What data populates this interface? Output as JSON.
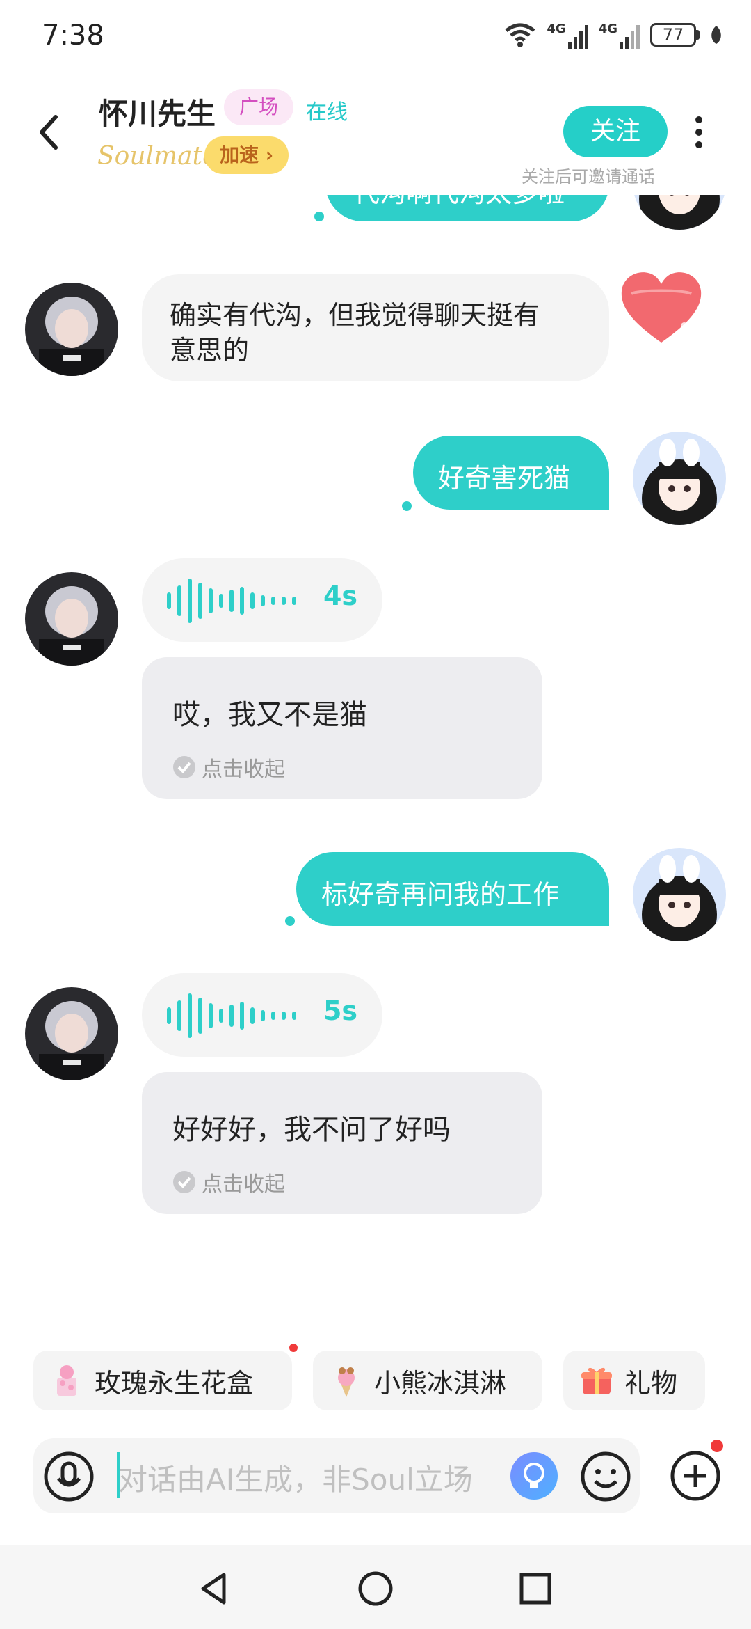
{
  "status_bar": {
    "time": "7:38",
    "battery": "77",
    "network_1": "4G",
    "network_2": "4G"
  },
  "header": {
    "name": "怀川先生",
    "tag": "广场",
    "online": "在线",
    "soulmate": "Soulmate",
    "speed_label": "加速 ›",
    "follow_label": "关注",
    "follow_hint": "关注后可邀请通话"
  },
  "messages": [
    {
      "from": "me",
      "text": "代沟啊代沟太多啦"
    },
    {
      "from": "other",
      "text_line1": "确实有代沟，但我觉得聊天挺有",
      "text_line2": "意思的"
    },
    {
      "from": "me",
      "text": "好奇害死猫"
    },
    {
      "from": "other",
      "type": "voice",
      "duration": "4s",
      "transcript": "哎，我又不是猫",
      "collapse": "点击收起"
    },
    {
      "from": "me",
      "text": "标好奇再问我的工作"
    },
    {
      "from": "other",
      "type": "voice",
      "duration": "5s",
      "transcript": "好好好，我不问了好吗",
      "collapse": "点击收起"
    }
  ],
  "gifts": [
    {
      "label": "玫瑰永生花盒"
    },
    {
      "label": "小熊冰淇淋"
    },
    {
      "label": "礼物"
    }
  ],
  "input": {
    "placeholder": "对话由AI生成，非Soul立场"
  },
  "colors": {
    "accent": "#2ecfc9",
    "bubble_other": "#f4f4f4",
    "tag_bg": "#fbe8f6",
    "tag_fg": "#d44fc0",
    "speed_bg": "#fbdb6c"
  }
}
